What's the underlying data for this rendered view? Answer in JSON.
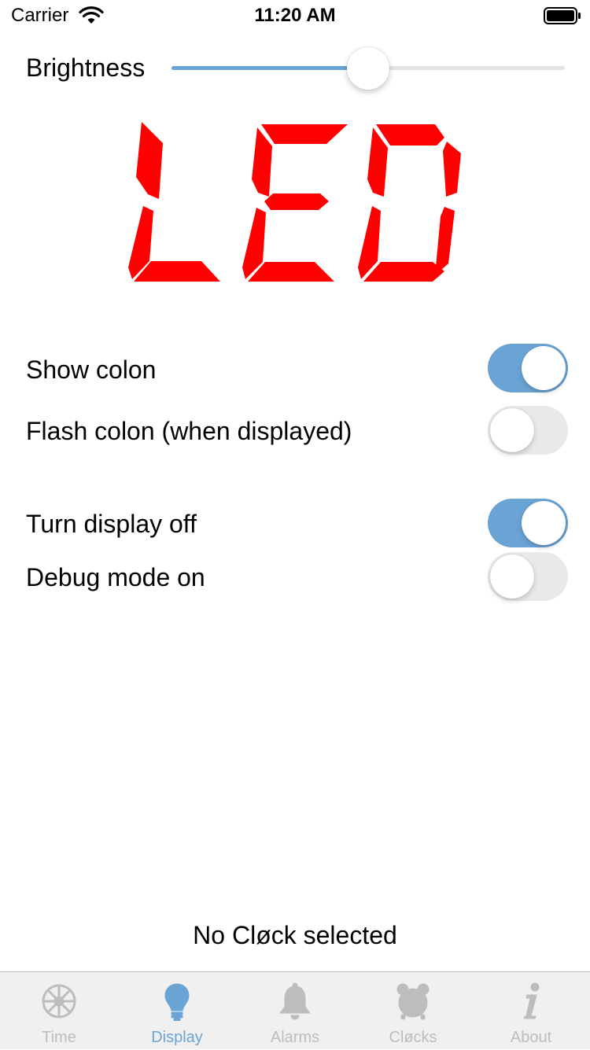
{
  "status_bar": {
    "carrier": "Carrier",
    "time": "11:20 AM"
  },
  "brightness": {
    "label": "Brightness",
    "value": 0.5
  },
  "display_preview": {
    "text": "LED",
    "color": "#ff0000"
  },
  "toggles": [
    {
      "label": "Show colon",
      "on": true
    },
    {
      "label": "Flash colon (when displayed)",
      "on": false
    },
    {
      "label": "Turn display off",
      "on": true
    },
    {
      "label": "Debug mode on",
      "on": false
    }
  ],
  "footer": {
    "status": "No Cløck selected"
  },
  "tab_bar": {
    "active": 1,
    "tabs": [
      {
        "label": "Time",
        "icon": "gear-icon"
      },
      {
        "label": "Display",
        "icon": "lightbulb-icon"
      },
      {
        "label": "Alarms",
        "icon": "bell-icon"
      },
      {
        "label": "Cløcks",
        "icon": "alarm-clock-icon"
      },
      {
        "label": "About",
        "icon": "info-icon"
      }
    ]
  },
  "colors": {
    "accent": "#6aa4d4",
    "inactive": "#bdbdbd",
    "led": "#ff0000"
  }
}
